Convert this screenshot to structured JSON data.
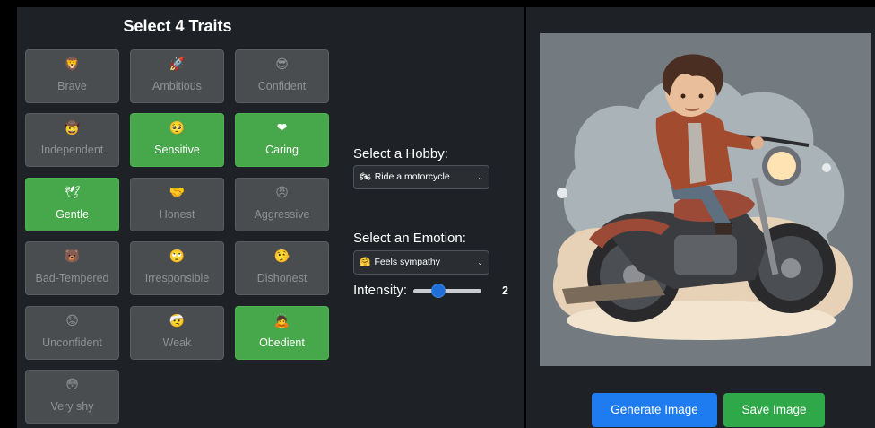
{
  "traits_title": "Select 4 Traits",
  "traits": [
    {
      "icon": "🦁",
      "label": "Brave",
      "selected": false
    },
    {
      "icon": "🚀",
      "label": "Ambitious",
      "selected": false
    },
    {
      "icon": "😎",
      "label": "Confident",
      "selected": false
    },
    {
      "icon": "🤠",
      "label": "Independent",
      "selected": false
    },
    {
      "icon": "🥺",
      "label": "Sensitive",
      "selected": true
    },
    {
      "icon": "❤",
      "label": "Caring",
      "selected": true
    },
    {
      "icon": "🕊",
      "label": "Gentle",
      "selected": true
    },
    {
      "icon": "🤝",
      "label": "Honest",
      "selected": false
    },
    {
      "icon": "😠",
      "label": "Aggressive",
      "selected": false
    },
    {
      "icon": "🐻",
      "label": "Bad-Tempered",
      "selected": false
    },
    {
      "icon": "🙄",
      "label": "Irresponsible",
      "selected": false
    },
    {
      "icon": "🤥",
      "label": "Dishonest",
      "selected": false
    },
    {
      "icon": "😟",
      "label": "Unconfident",
      "selected": false
    },
    {
      "icon": "🤕",
      "label": "Weak",
      "selected": false
    },
    {
      "icon": "🙇",
      "label": "Obedient",
      "selected": true
    },
    {
      "icon": "😳",
      "label": "Very shy",
      "selected": false
    }
  ],
  "hobby": {
    "label": "Select a Hobby:",
    "icon": "🏍",
    "value": "Ride a motorcycle"
  },
  "emotion": {
    "label": "Select an Emotion:",
    "icon": "🤗",
    "value": "Feels sympathy"
  },
  "intensity": {
    "label": "Intensity:",
    "value": "2",
    "level_fraction": 0.33
  },
  "buttons": {
    "generate": "Generate Image",
    "save": "Save Image"
  },
  "colors": {
    "selected_trait": "#46a84a",
    "generate_button": "#1e7cf0",
    "save_button": "#2fa84a",
    "slider_thumb": "#1f6fd6"
  }
}
